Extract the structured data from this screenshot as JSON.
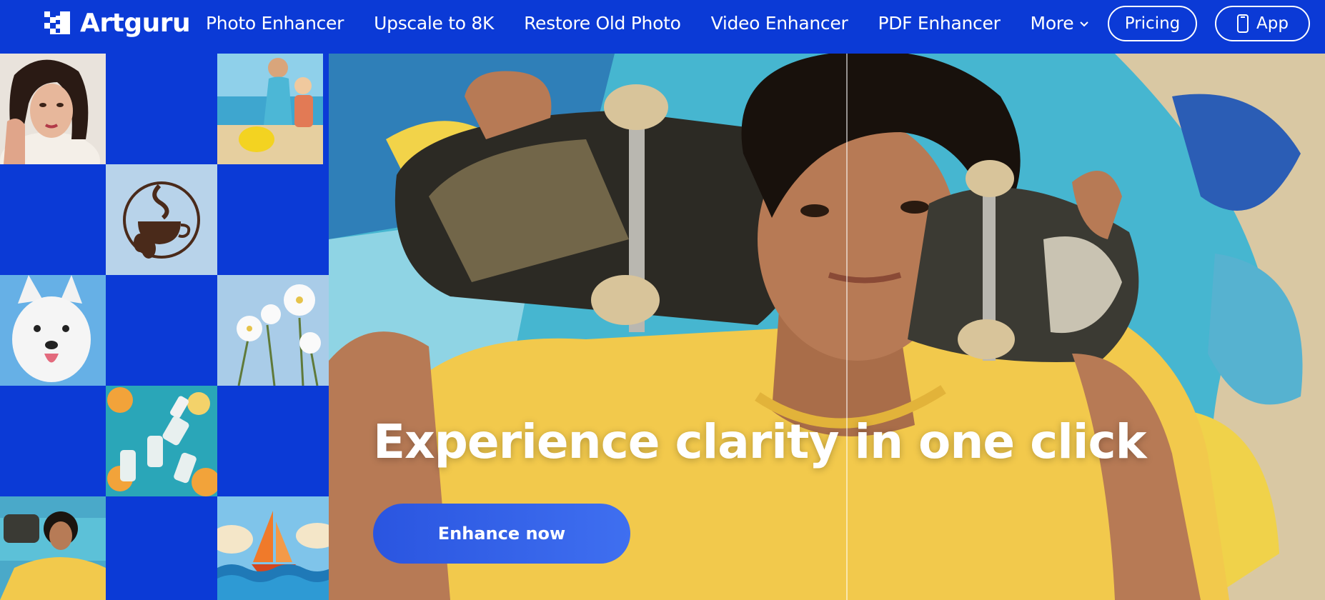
{
  "brand": {
    "name": "Artguru"
  },
  "nav": {
    "links": [
      {
        "label": "Photo Enhancer"
      },
      {
        "label": "Upscale to 8K"
      },
      {
        "label": "Restore Old Photo"
      },
      {
        "label": "Video Enhancer"
      },
      {
        "label": "PDF Enhancer"
      }
    ],
    "more_label": "More",
    "pricing_label": "Pricing",
    "app_label": "App"
  },
  "hero": {
    "headline": "Experience clarity in one click",
    "cta_label": "Enhance now"
  },
  "colors": {
    "brand_blue": "#0b3ad6",
    "cta_blue": "#2f5fe8",
    "tshirt_yellow": "#f2c94c"
  }
}
